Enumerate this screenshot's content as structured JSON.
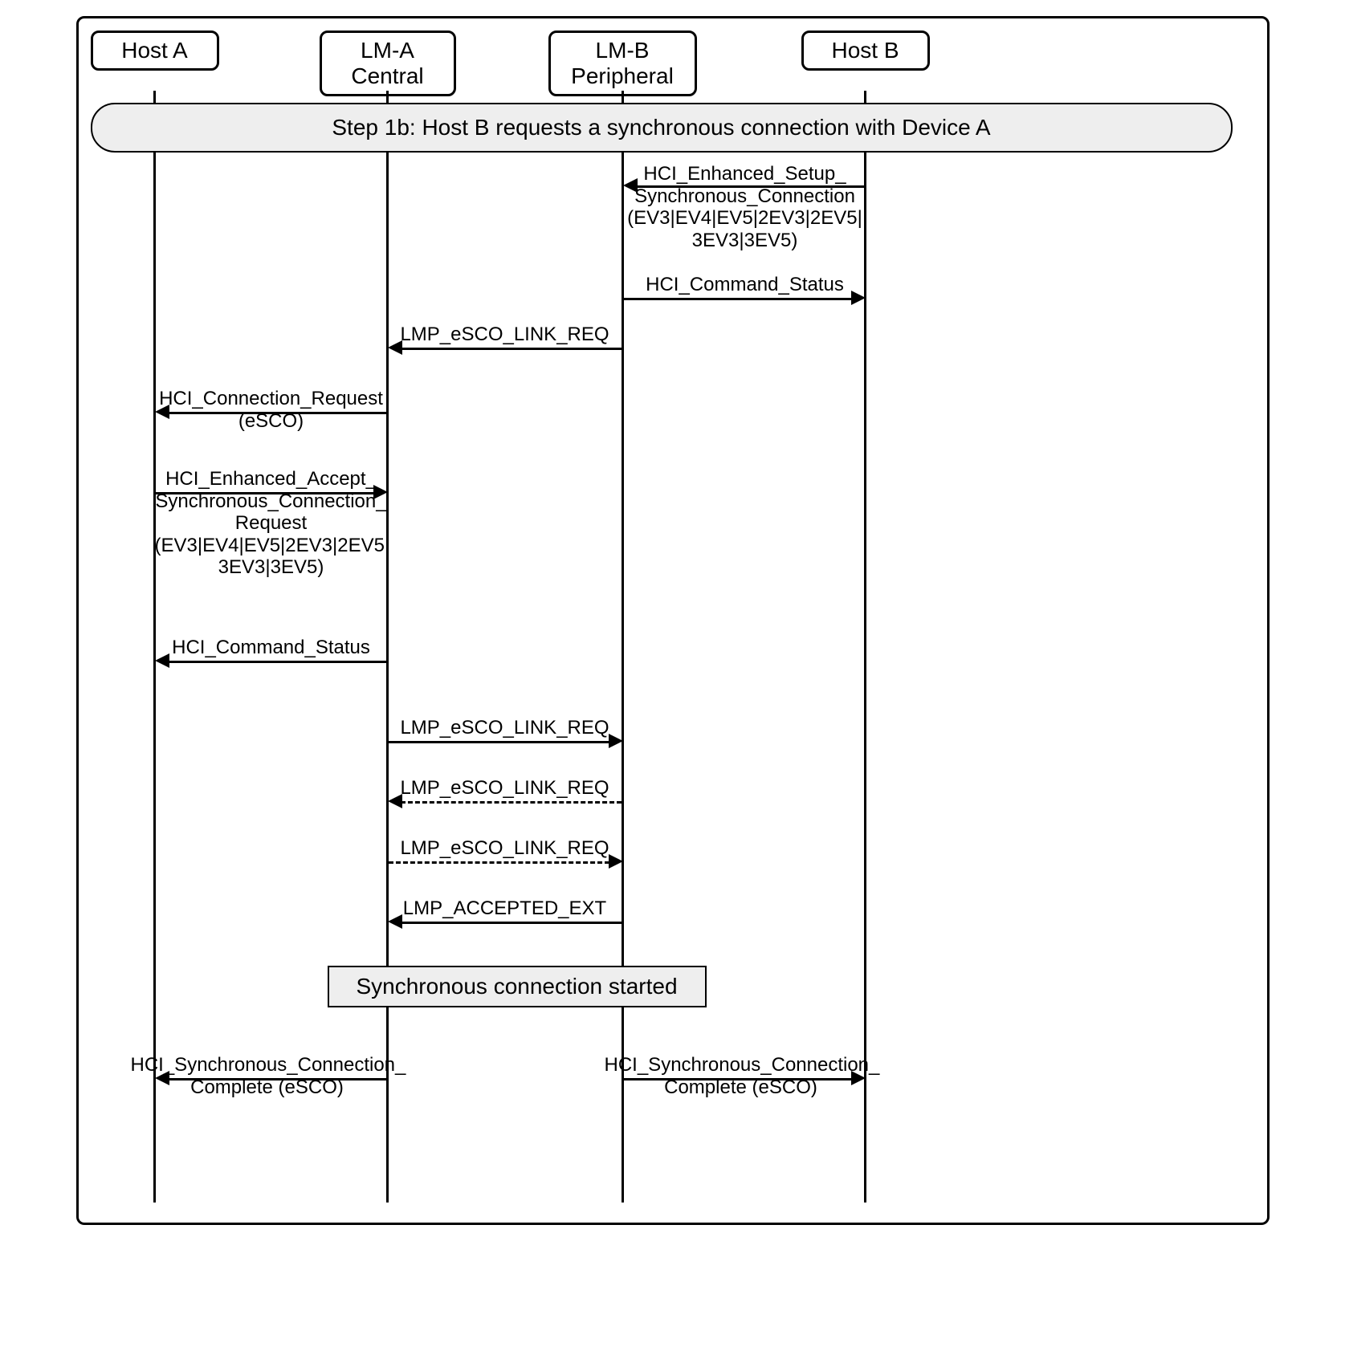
{
  "participants": {
    "hostA": {
      "label": "Host A"
    },
    "lmA": {
      "label": "LM-A\nCentral"
    },
    "lmB": {
      "label": "LM-B\nPeripheral"
    },
    "hostB": {
      "label": "Host B"
    }
  },
  "step_banner": "Step 1b:  Host B requests a synchronous connection with Device A",
  "messages": {
    "m1": "HCI_Enhanced_Setup_\nSynchronous_Connection\n(EV3|EV4|EV5|2EV3|2EV5|\n3EV3|3EV5)",
    "m2": "HCI_Command_Status",
    "m3": "LMP_eSCO_LINK_REQ",
    "m4": "HCI_Connection_Request\n(eSCO)",
    "m5": "HCI_Enhanced_Accept_\nSynchronous_Connection_\nRequest\n(EV3|EV4|EV5|2EV3|2EV5|\n3EV3|3EV5)",
    "m6": "HCI_Command_Status",
    "m7": "LMP_eSCO_LINK_REQ",
    "m8": "LMP_eSCO_LINK_REQ",
    "m9": "LMP_eSCO_LINK_REQ",
    "m10": "LMP_ACCEPTED_EXT",
    "m11": "HCI_Synchronous_Connection_\nComplete (eSCO)",
    "m12": "HCI_Synchronous_Connection_\nComplete (eSCO)"
  },
  "state_box": "Synchronous connection started"
}
